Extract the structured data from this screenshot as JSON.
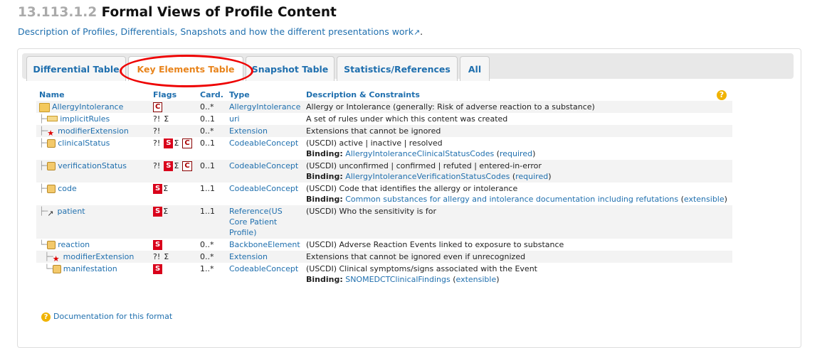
{
  "heading": {
    "number": "13.113.1.2",
    "title": "Formal Views of Profile Content"
  },
  "description_link": "Description of Profiles, Differentials, Snapshots and how the different presentations work",
  "tabs": [
    {
      "label": "Differential Table",
      "active": false
    },
    {
      "label": "Key Elements Table",
      "active": true
    },
    {
      "label": "Snapshot Table",
      "active": false
    },
    {
      "label": "Statistics/References",
      "active": false
    },
    {
      "label": "All",
      "active": false
    }
  ],
  "columns": {
    "name": "Name",
    "flags": "Flags",
    "card": "Card.",
    "type": "Type",
    "desc": "Description & Constraints"
  },
  "rows": [
    {
      "name": "AllergyIntolerance",
      "flags": [
        "C"
      ],
      "card": "0..*",
      "type": "AllergyIntolerance",
      "desc": "Allergy or Intolerance (generally: Risk of adverse reaction to a substance)",
      "binding": null
    },
    {
      "name": "implicitRules",
      "flags": [
        "?!",
        "Σ"
      ],
      "card": "0..1",
      "type": "uri",
      "desc": "A set of rules under which this content was created",
      "binding": null
    },
    {
      "name": "modifierExtension",
      "flags": [
        "?!"
      ],
      "card": "0..*",
      "type": "Extension",
      "desc": "Extensions that cannot be ignored",
      "binding": null
    },
    {
      "name": "clinicalStatus",
      "flags": [
        "?!",
        "S",
        "Σ",
        "C"
      ],
      "card": "0..1",
      "type": "CodeableConcept",
      "desc": "(USCDI) active | inactive | resolved",
      "binding": {
        "label": "Binding:",
        "valueset": "AllergyIntoleranceClinicalStatusCodes",
        "strength": "required"
      }
    },
    {
      "name": "verificationStatus",
      "flags": [
        "?!",
        "S",
        "Σ",
        "C"
      ],
      "card": "0..1",
      "type": "CodeableConcept",
      "desc": "(USCDI) unconfirmed | confirmed | refuted | entered-in-error",
      "binding": {
        "label": "Binding:",
        "valueset": "AllergyIntoleranceVerificationStatusCodes",
        "strength": "required"
      }
    },
    {
      "name": "code",
      "flags": [
        "S",
        "Σ"
      ],
      "card": "1..1",
      "type": "CodeableConcept",
      "desc": "(USCDI) Code that identifies the allergy or intolerance",
      "binding": {
        "label": "Binding:",
        "valueset": "Common substances for allergy and intolerance documentation including refutations",
        "strength": "extensible"
      }
    },
    {
      "name": "patient",
      "flags": [
        "S",
        "Σ"
      ],
      "card": "1..1",
      "type": "Reference(US Core Patient Profile)",
      "desc": "(USCDI) Who the sensitivity is for",
      "binding": null
    },
    {
      "name": "reaction",
      "flags": [
        "S"
      ],
      "card": "0..*",
      "type": "BackboneElement",
      "desc": "(USCDI) Adverse Reaction Events linked to exposure to substance",
      "binding": null
    },
    {
      "name": "modifierExtension",
      "flags": [
        "?!",
        "Σ"
      ],
      "card": "0..*",
      "type": "Extension",
      "desc": "Extensions that cannot be ignored even if unrecognized",
      "binding": null
    },
    {
      "name": "manifestation",
      "flags": [
        "S"
      ],
      "card": "1..*",
      "type": "CodeableConcept",
      "desc": "(USCDI) Clinical symptoms/signs associated with the Event",
      "binding": {
        "label": "Binding:",
        "valueset": "SNOMEDCTClinicalFindings",
        "strength": "extensible"
      }
    }
  ],
  "doc_link": "Documentation for this format",
  "colors": {
    "link": "#1f6fae",
    "active_tab": "#e8841c",
    "must_support": "#d9001b",
    "highlight_oval": "#e00000"
  }
}
